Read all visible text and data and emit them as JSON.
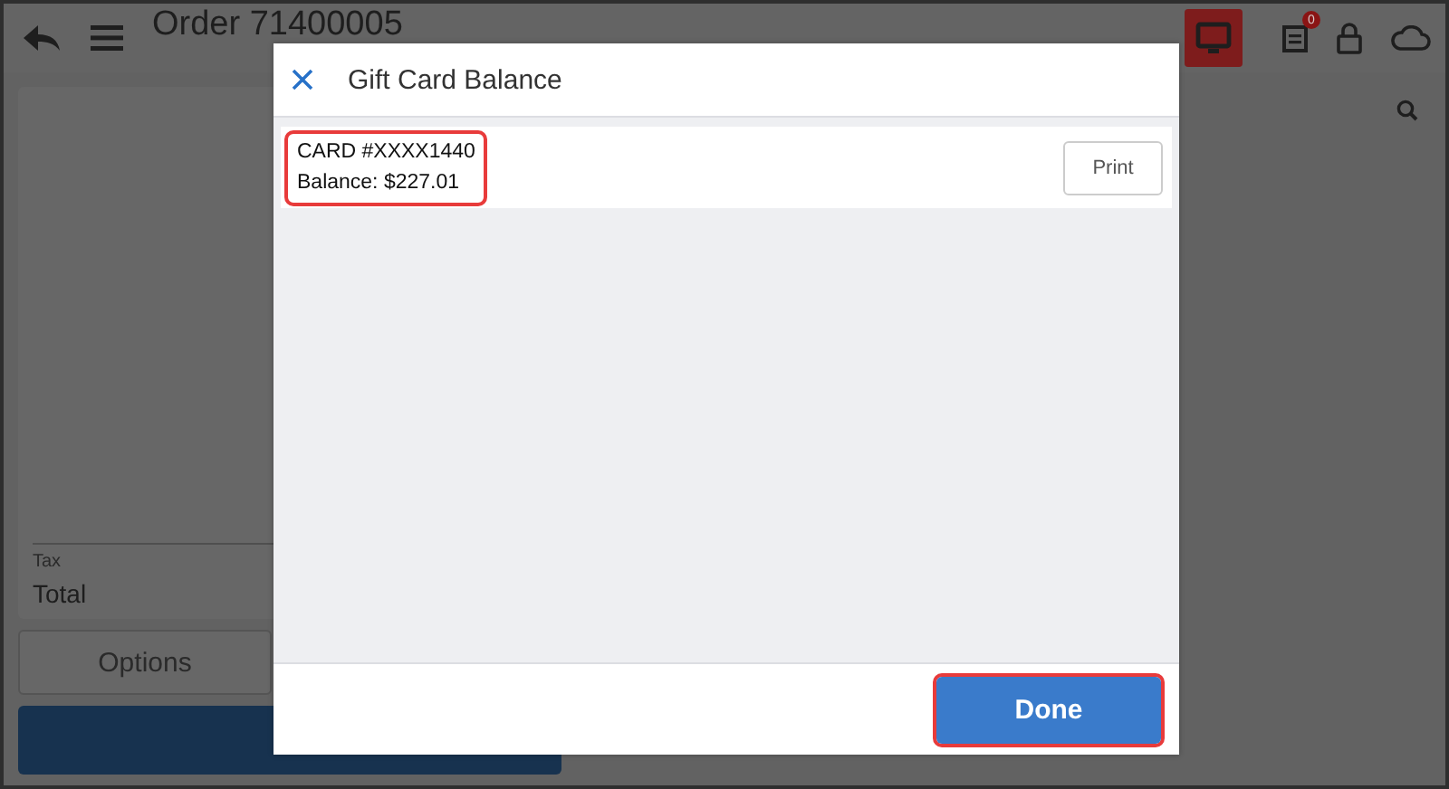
{
  "toolbar": {
    "title": "Order 71400005",
    "display_active": true,
    "notification_count": "0"
  },
  "summary": {
    "rows": [
      {
        "label": "Tax",
        "kind": "minor"
      },
      {
        "label": "Total",
        "kind": "major"
      }
    ]
  },
  "buttons": [
    {
      "label": "Options",
      "kind": "secondary"
    },
    {
      "kind": "primary"
    }
  ],
  "dialog": {
    "title": "Gift Card Balance",
    "cards": [
      {
        "lines": [
          "CARD #XXXX1440",
          "Balance: $227.01"
        ],
        "highlighted": true,
        "action": "Print"
      }
    ],
    "done_button": {
      "label": "Done",
      "highlighted": true
    }
  }
}
